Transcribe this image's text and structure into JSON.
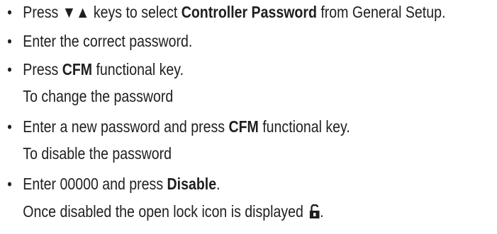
{
  "bullet_glyph": "•",
  "items": [
    {
      "before": "Press ",
      "arrows": "▼▲",
      "middle": " keys to select ",
      "bold": "Controller Password",
      "after": " from General Setup."
    },
    {
      "text": "Enter the correct password."
    },
    {
      "before": "Press ",
      "bold": "CFM",
      "after": " functional key."
    },
    {
      "note": "To change the  password"
    },
    {
      "before": "Enter a new password and press ",
      "bold": "CFM",
      "after": " functional key."
    },
    {
      "note": "To disable the password"
    },
    {
      "before": "Enter 00000 and press ",
      "bold": "Disable",
      "after": "."
    },
    {
      "note_before": "Once disabled the open lock icon is displayed ",
      "icon": "open-lock-icon",
      "note_after": "."
    }
  ]
}
